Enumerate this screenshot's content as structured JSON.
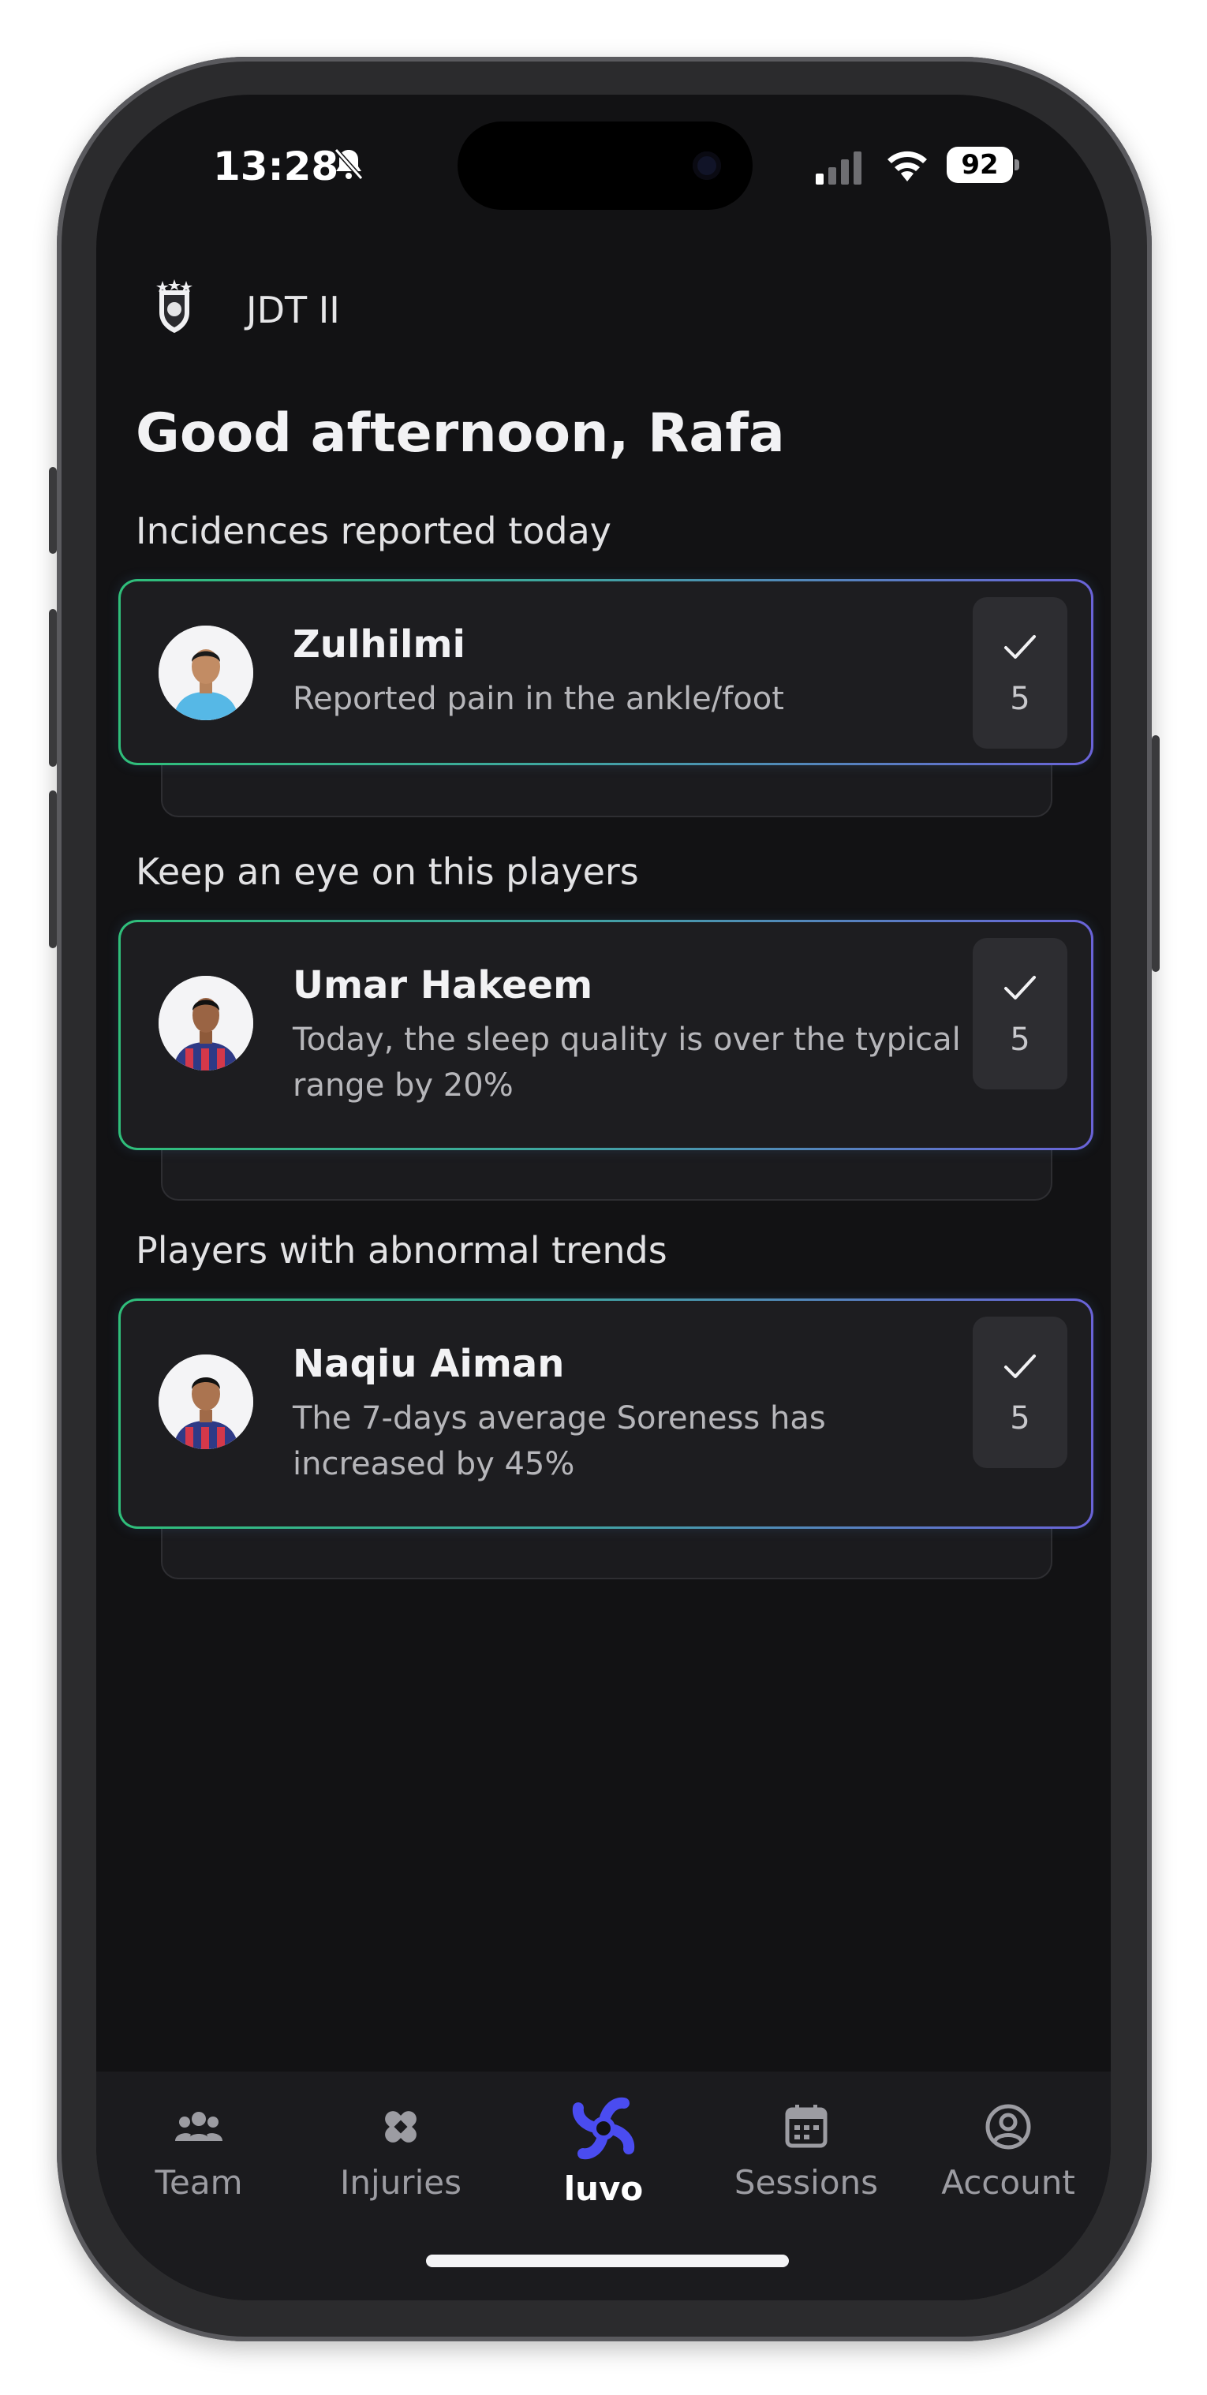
{
  "status_bar": {
    "time": "13:28",
    "battery": "92"
  },
  "header": {
    "team_name": "JDT II",
    "greeting": "Good afternoon, Rafa"
  },
  "sections": [
    {
      "title": "Incidences reported today",
      "card": {
        "player": "Zulhilmi",
        "description": "Reported pain in the ankle/foot",
        "count": "5"
      }
    },
    {
      "title": "Keep an eye on this players",
      "card": {
        "player": "Umar Hakeem",
        "description": "Today, the sleep quality is over the typical range by 20%",
        "count": "5"
      }
    },
    {
      "title": "Players with abnormal trends",
      "card": {
        "player": "Naqiu Aiman",
        "description": "The 7-days average Soreness has increased by 45%",
        "count": "5"
      }
    }
  ],
  "tabbar": {
    "items": [
      {
        "label": "Team",
        "icon": "team-icon"
      },
      {
        "label": "Injuries",
        "icon": "bandage-icon"
      },
      {
        "label": "luvo",
        "icon": "luvo-logo-icon",
        "active": true
      },
      {
        "label": "Sessions",
        "icon": "calendar-icon"
      },
      {
        "label": "Account",
        "icon": "account-icon"
      }
    ]
  },
  "colors": {
    "accent_green": "#2fbf7a",
    "accent_purple": "#6a63d8",
    "luvo_blue": "#4a4cf0",
    "background": "#121214"
  }
}
